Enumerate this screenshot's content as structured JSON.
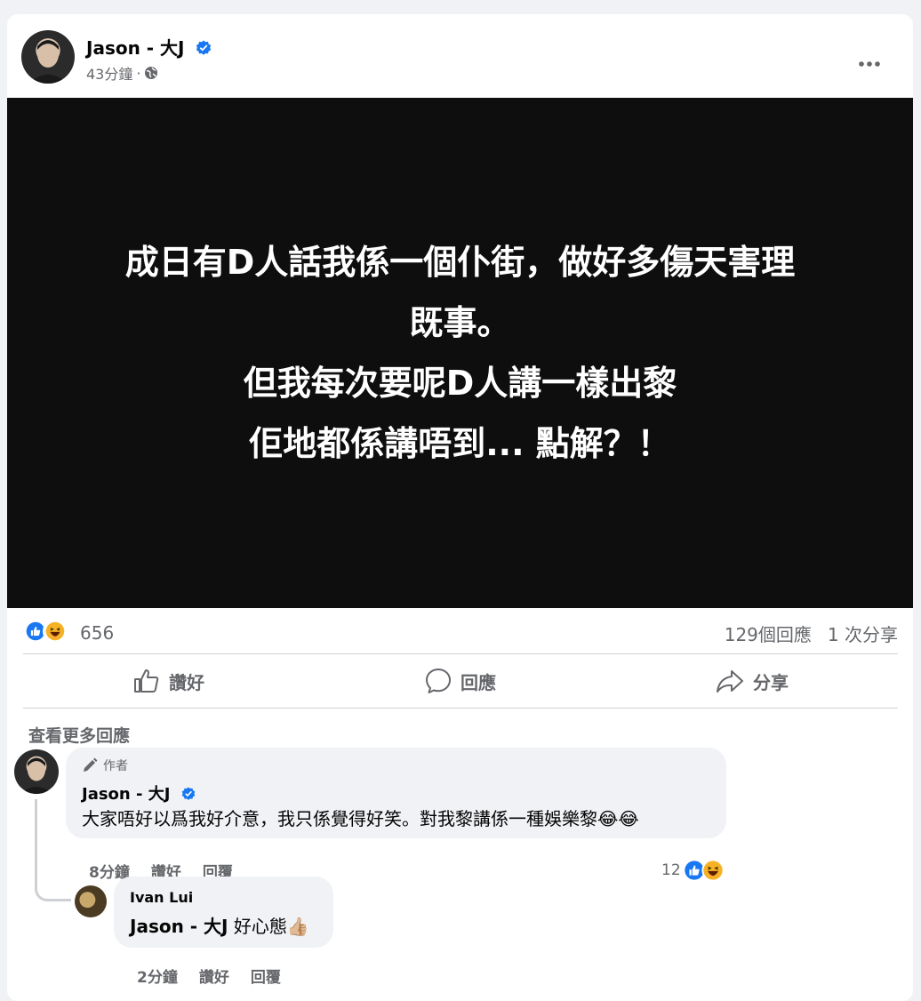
{
  "post": {
    "author": "Jason - 大J",
    "time": "43分鐘",
    "privacy_icon": "globe-icon",
    "media_lines": [
      "成日有D人話我係一個仆街，做好多傷天害理",
      "既事。",
      "但我每次要呢D人講一樣出黎",
      "佢地都係講唔到... 點解？！"
    ],
    "reaction_count": "656",
    "comments_count": "129個回應",
    "shares_count": "1 次分享"
  },
  "actions": {
    "like": "讚好",
    "comment": "回應",
    "share": "分享"
  },
  "more_comments": "查看更多回應",
  "comment": {
    "badge": "作者",
    "name": "Jason - 大J",
    "text": "大家唔好以爲我好介意，我只係覺得好笑。對我黎講係一種娛樂黎😂😂",
    "time": "8分鐘",
    "like": "讚好",
    "reply": "回覆",
    "reaction_count": "12"
  },
  "reply": {
    "name": "Ivan Lui",
    "mention": "Jason - 大J",
    "text": " 好心態👍🏼",
    "time": "2分鐘",
    "like": "讚好",
    "reply": "回覆"
  },
  "colors": {
    "facebook_blue": "#1877f2",
    "secondary_text": "#65676b",
    "media_bg": "#0e0e0e"
  }
}
